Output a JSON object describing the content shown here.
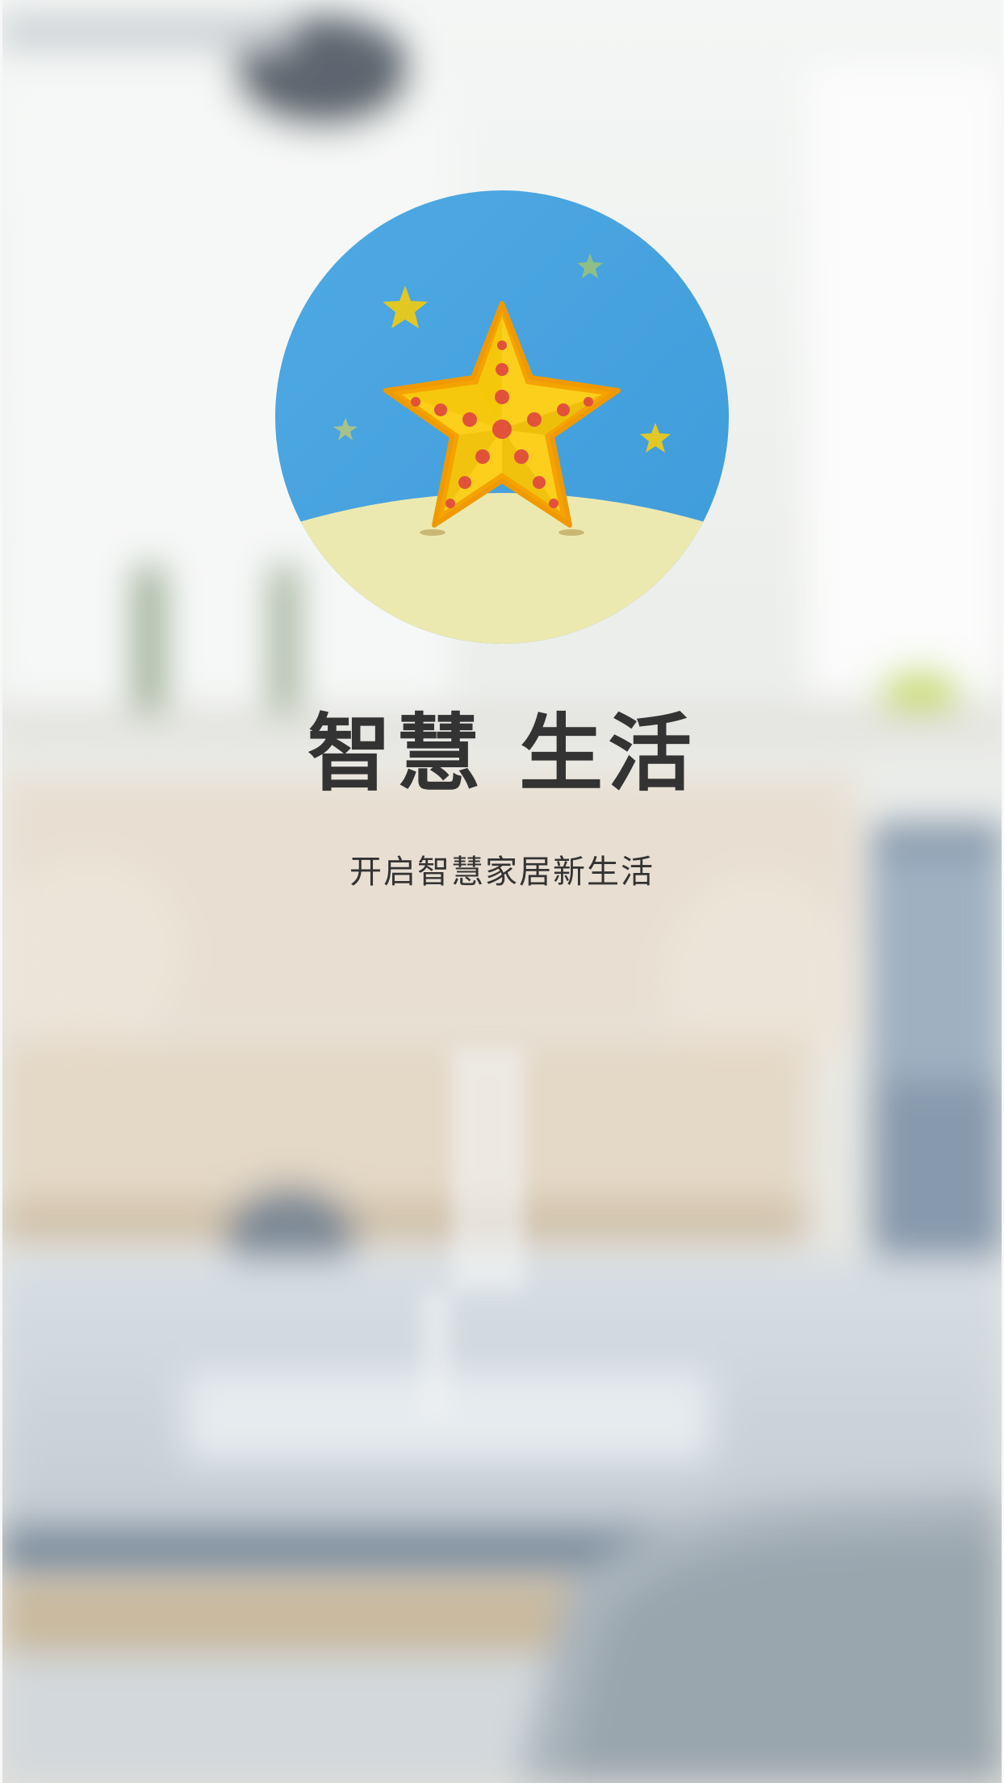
{
  "app": {
    "title": "智慧 生活",
    "subtitle": "开启智慧家居新生活"
  },
  "logo": {
    "icon": "starfish-on-sand-icon",
    "colors": {
      "sky": "#4aa6e0",
      "sand": "#ece9b0",
      "star": "#f7c300",
      "star_outline": "#f0a000",
      "dots": "#e2523a"
    }
  },
  "background": {
    "description_icon": "blurred-living-room-photo",
    "colors": {
      "wall": "#eef0ee",
      "sofa": "#e7ddcf",
      "table": "#cfd9e1",
      "floor": "#c7cdd2"
    }
  }
}
